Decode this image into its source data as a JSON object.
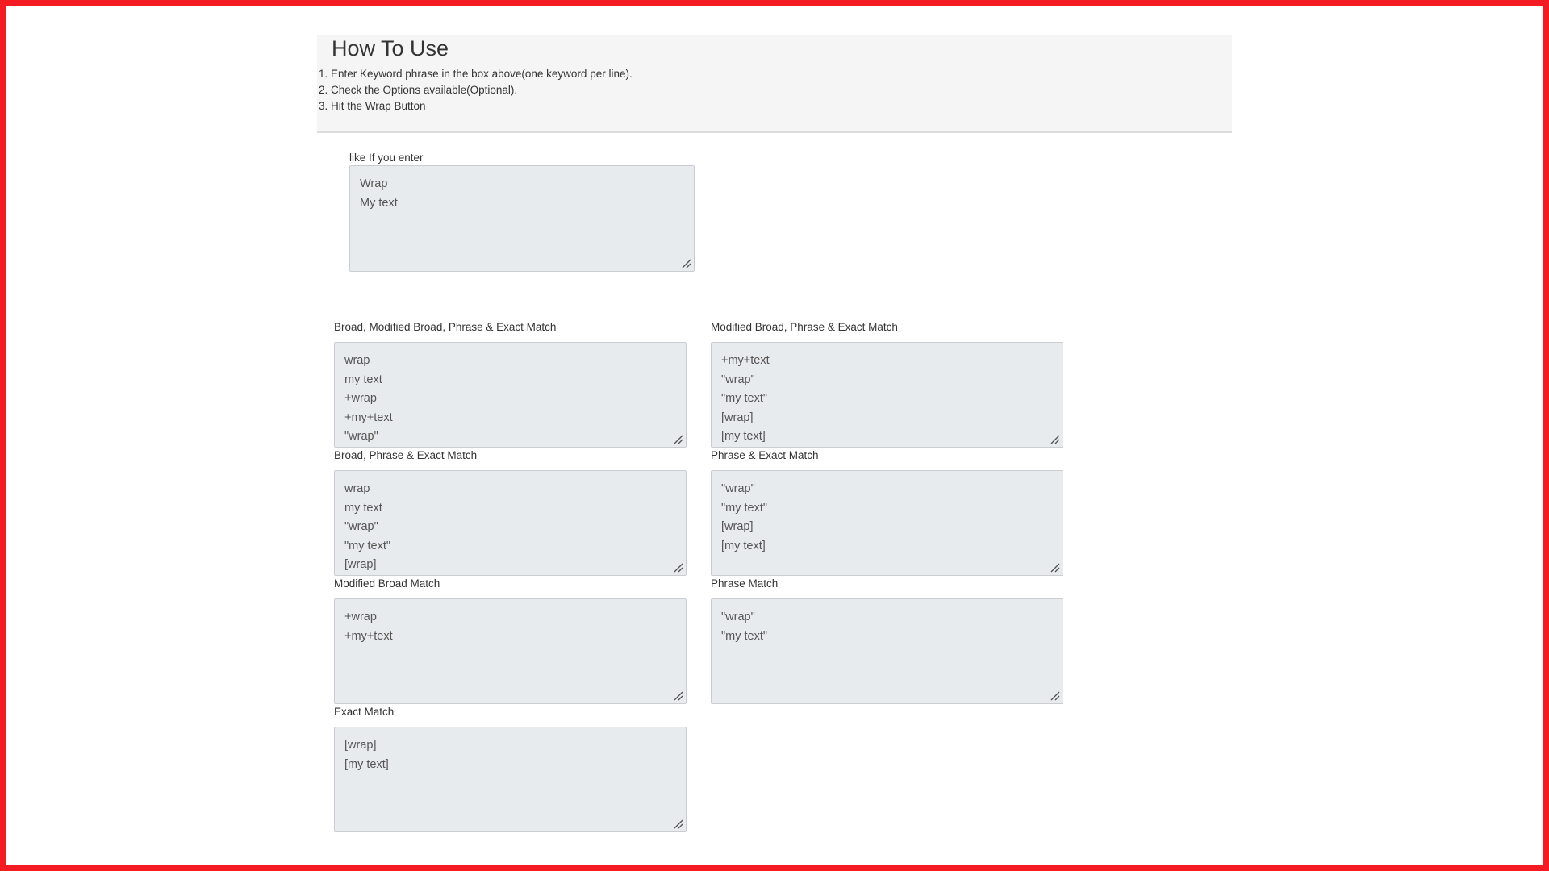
{
  "how_to": {
    "title": "How To Use",
    "steps": [
      "1. Enter Keyword phrase in the box above(one keyword per line).",
      "2. Check the Options available(Optional).",
      "3. Hit the Wrap Button"
    ]
  },
  "example_input": {
    "label": "like If you enter",
    "lines": [
      "Wrap",
      "My text"
    ]
  },
  "outputs": {
    "broad_modified_phrase_exact": {
      "label": "Broad, Modified Broad, Phrase & Exact Match",
      "lines": [
        "wrap",
        "my text",
        "+wrap",
        "+my+text",
        "\"wrap\""
      ]
    },
    "modified_phrase_exact": {
      "label": "Modified Broad, Phrase & Exact Match",
      "lines": [
        "+my+text",
        "\"wrap\"",
        "\"my text\"",
        "[wrap]",
        "[my text]"
      ]
    },
    "broad_phrase_exact": {
      "label": "Broad, Phrase & Exact Match",
      "lines": [
        "wrap",
        "my text",
        "\"wrap\"",
        "\"my text\"",
        "[wrap]"
      ]
    },
    "phrase_exact": {
      "label": "Phrase & Exact Match",
      "lines": [
        "\"wrap\"",
        "\"my text\"",
        "[wrap]",
        "[my text]"
      ]
    },
    "modified_broad": {
      "label": "Modified Broad Match",
      "lines": [
        "+wrap",
        "+my+text"
      ]
    },
    "phrase": {
      "label": "Phrase Match",
      "lines": [
        "\"wrap\"",
        "\"my text\""
      ]
    },
    "exact": {
      "label": "Exact Match",
      "lines": [
        "[wrap]",
        "[my text]"
      ]
    }
  }
}
